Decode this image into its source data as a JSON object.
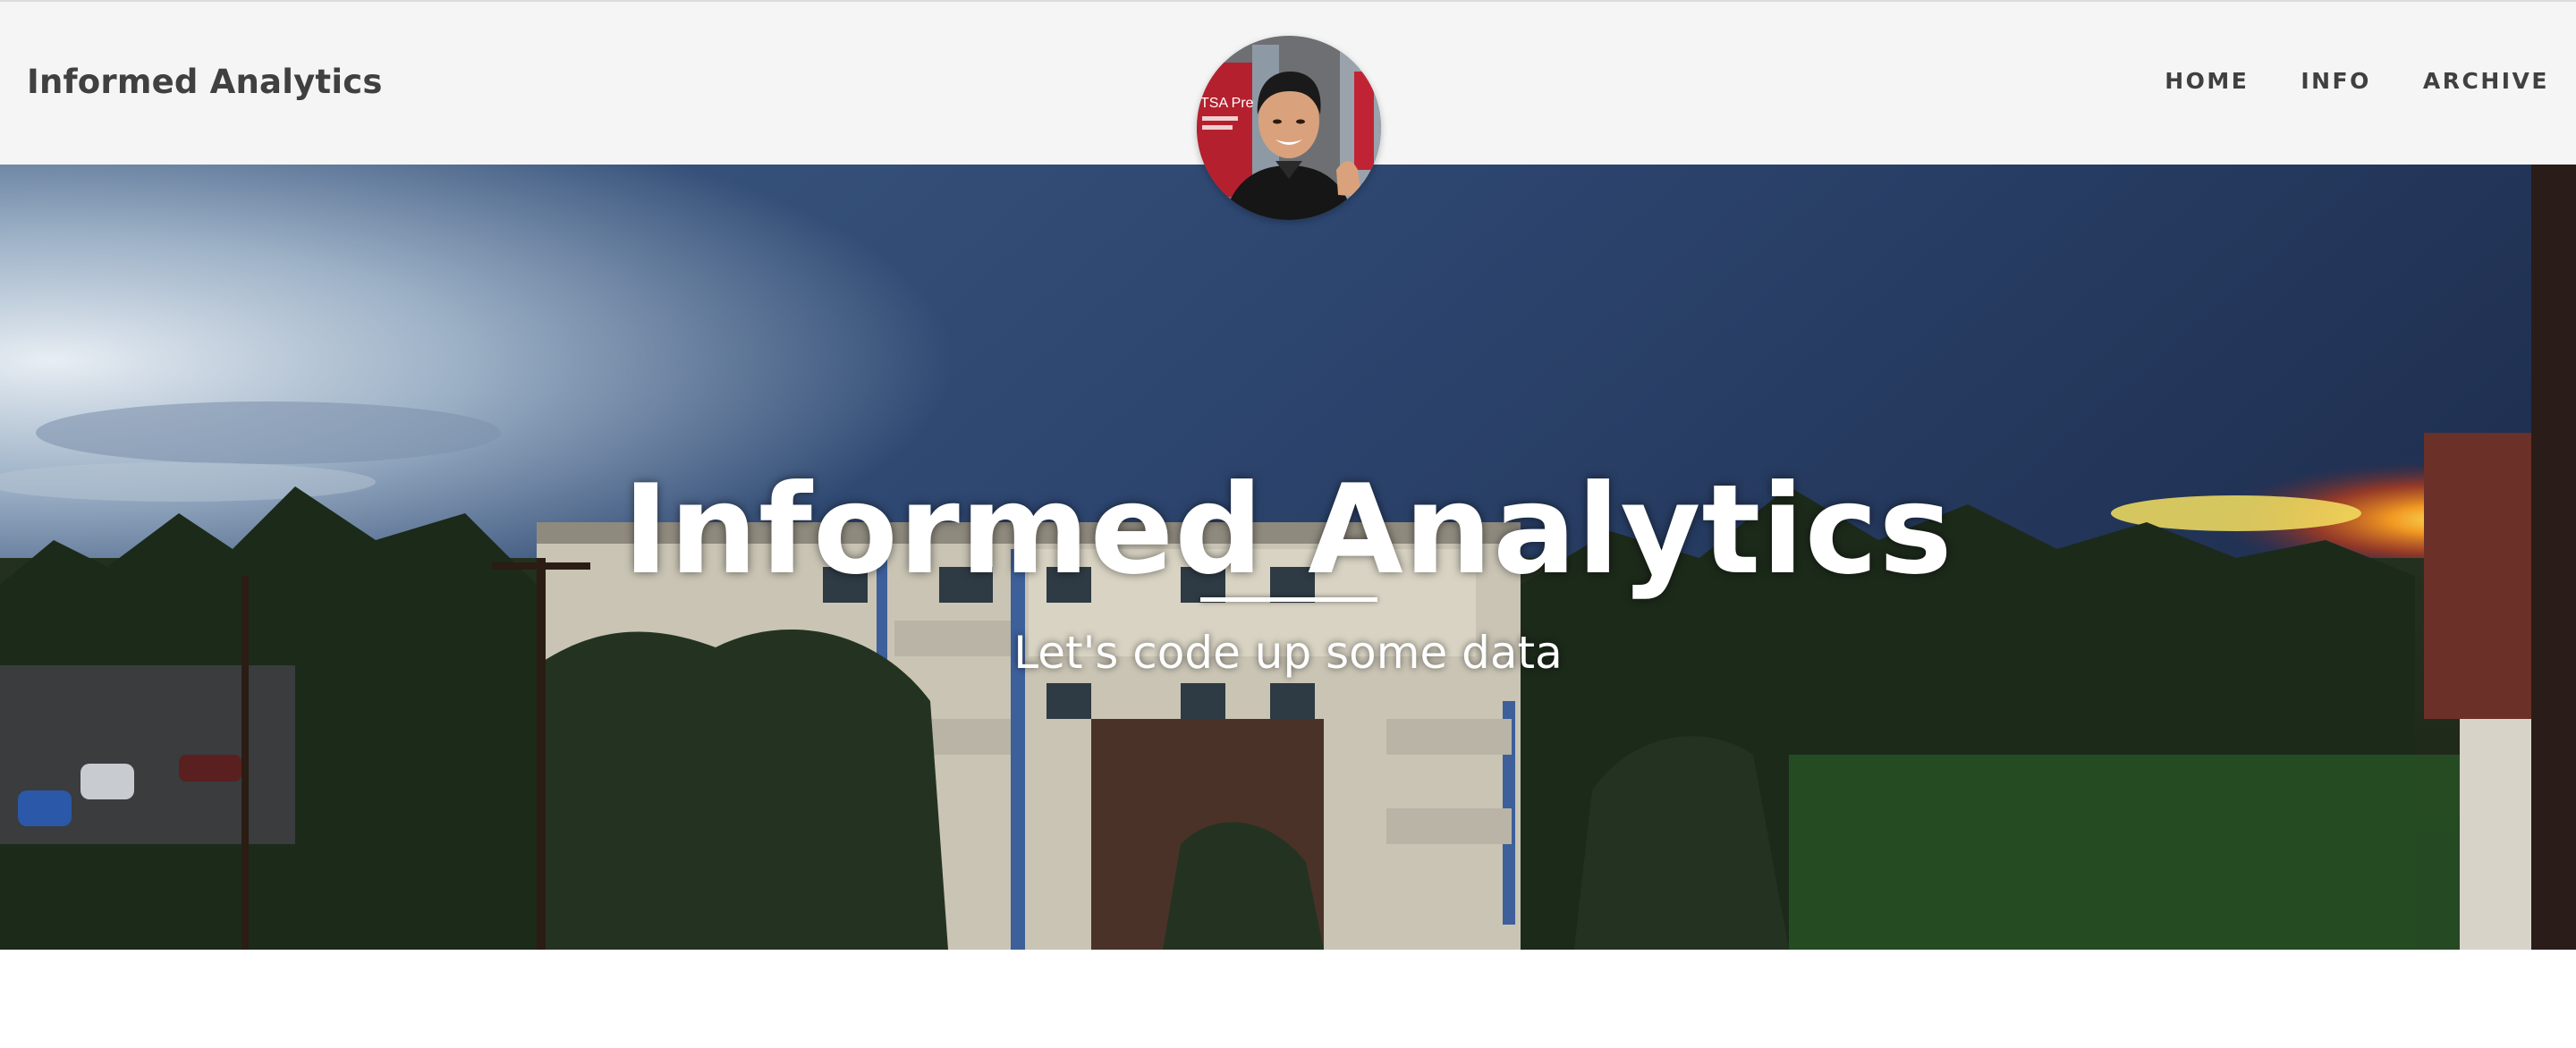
{
  "navbar": {
    "brand": "Informed Analytics",
    "links": [
      {
        "label": "HOME"
      },
      {
        "label": "INFO"
      },
      {
        "label": "ARCHIVE"
      }
    ]
  },
  "hero": {
    "title": "Informed Analytics",
    "subtitle": "Let's code up some data"
  },
  "avatar": {
    "alt": "profile photo",
    "sign_text": "TSA Pre"
  },
  "colors": {
    "navbar_bg": "#f5f5f5",
    "nav_text": "#404040",
    "hero_text": "#ffffff"
  }
}
